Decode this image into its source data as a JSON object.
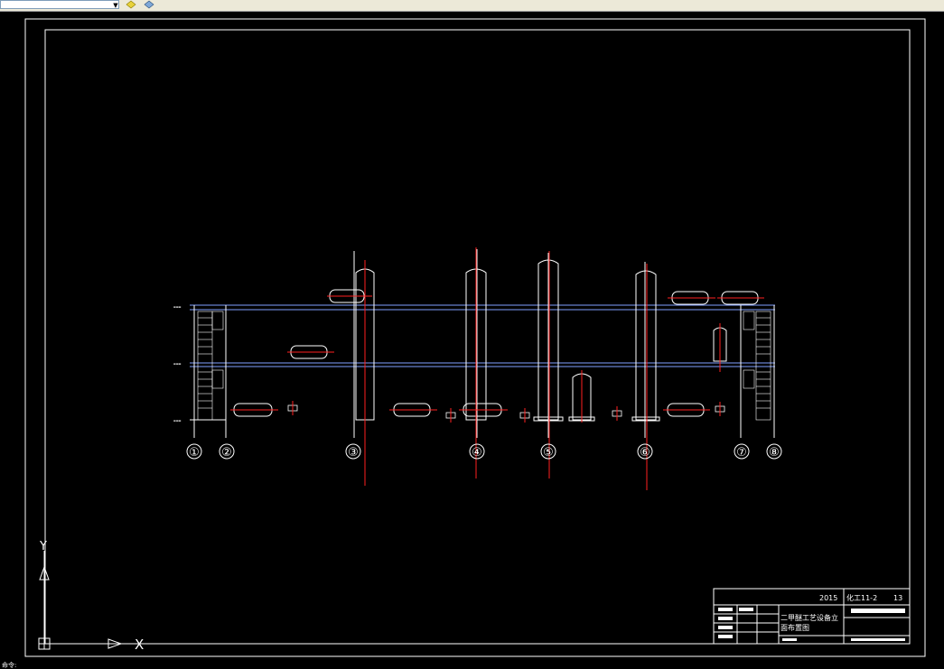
{
  "toolbar": {
    "combo_value": "",
    "combo_arrow": "▼",
    "buttons": [
      "layer-yellow-icon",
      "layer-blue-icon"
    ]
  },
  "drawing": {
    "grid_axes": [
      "①",
      "②",
      "③",
      "④",
      "⑤",
      "⑥",
      "⑦",
      "⑧"
    ],
    "title_block": {
      "year": "2015",
      "class": "化工11-2",
      "number": "13",
      "title_line1": "二甲醚工艺设备立",
      "title_line2": "面布置图"
    },
    "ucs": {
      "y_label": "Y",
      "x_label": "X"
    }
  },
  "command_line": {
    "text": "命令:"
  },
  "colors": {
    "background": "#000000",
    "frame": "#ffffff",
    "centerline": "#ff0000",
    "floor": "#7f9fff"
  }
}
